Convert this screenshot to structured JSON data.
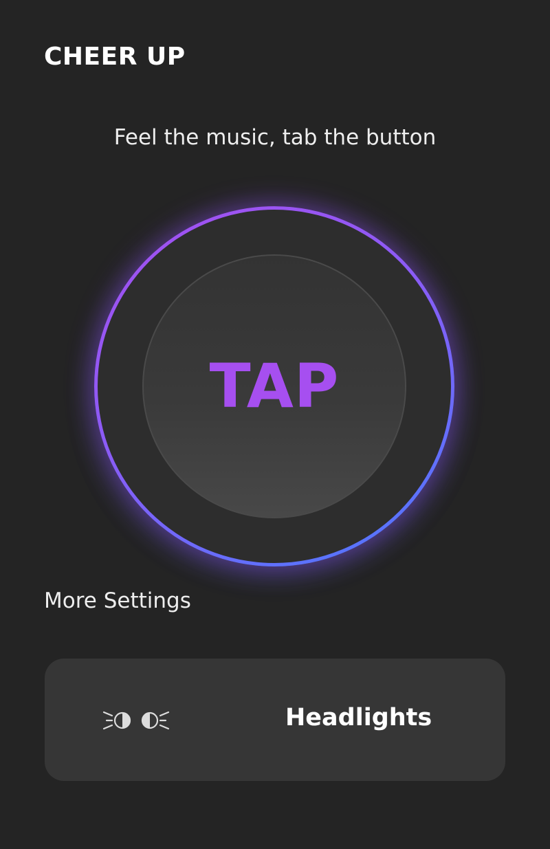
{
  "header": {
    "title": "CHEER UP"
  },
  "main": {
    "subtitle": "Feel the music, tab the button",
    "tap_button": {
      "label": "TAP"
    }
  },
  "settings": {
    "section_label": "More Settings",
    "items": [
      {
        "label": "Headlights",
        "icon": "headlights-icon"
      }
    ]
  },
  "colors": {
    "background": "#242424",
    "accent_purple": "#a64ff0",
    "accent_blue": "#4a7bff",
    "card": "#363636"
  }
}
